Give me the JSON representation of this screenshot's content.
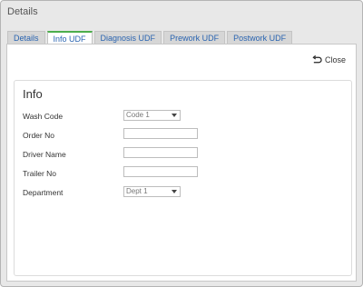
{
  "window": {
    "title": "Details"
  },
  "tabs": [
    {
      "label": "Details"
    },
    {
      "label": "Info UDF"
    },
    {
      "label": "Diagnosis UDF"
    },
    {
      "label": "Prework UDF"
    },
    {
      "label": "Postwork UDF"
    }
  ],
  "active_tab_index": 1,
  "toolbar": {
    "close_label": "Close",
    "close_icon": "undo-arrow-icon"
  },
  "panel": {
    "title": "Info",
    "fields": {
      "wash_code": {
        "label": "Wash Code",
        "value": "Code 1"
      },
      "order_no": {
        "label": "Order No",
        "value": ""
      },
      "driver_name": {
        "label": "Driver Name",
        "value": ""
      },
      "trailer_no": {
        "label": "Trailer No",
        "value": ""
      },
      "department": {
        "label": "Department",
        "value": "Dept 1"
      }
    }
  },
  "colors": {
    "active_tab_accent": "#4cae4c",
    "tab_text": "#2a64b0"
  }
}
